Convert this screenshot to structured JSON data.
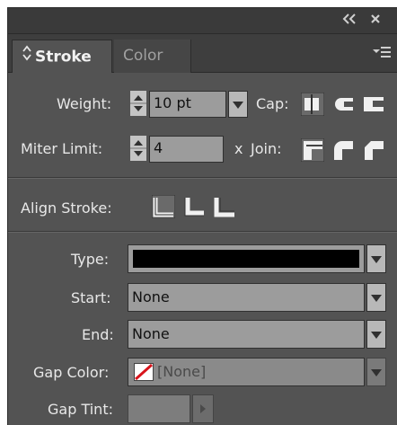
{
  "titlebar": {
    "collapse_icon": "double-chevron-left-icon",
    "close_icon": "close-icon"
  },
  "tabs": [
    {
      "label": "Stroke",
      "active": true,
      "icon": "updown-arrows-icon"
    },
    {
      "label": "Color",
      "active": false
    }
  ],
  "panel_menu_icon": "panel-menu-icon",
  "weight": {
    "label": "Weight:",
    "value": "10 pt"
  },
  "cap": {
    "label": "Cap:",
    "options": [
      "butt-cap-icon",
      "round-cap-icon",
      "projecting-cap-icon"
    ]
  },
  "miter": {
    "label": "Miter Limit:",
    "value": "4",
    "suffix": "x"
  },
  "join": {
    "label": "Join:",
    "options": [
      "miter-join-icon",
      "round-join-icon",
      "bevel-join-icon"
    ]
  },
  "align_stroke": {
    "label": "Align Stroke:",
    "options": [
      "align-center-icon",
      "align-inside-icon",
      "align-outside-icon"
    ]
  },
  "type": {
    "label": "Type:",
    "swatch_color": "#000000"
  },
  "start": {
    "label": "Start:",
    "value": "None"
  },
  "end": {
    "label": "End:",
    "value": "None"
  },
  "gap_color": {
    "label": "Gap Color:",
    "value": "[None]",
    "icon": "none-swatch-icon"
  },
  "gap_tint": {
    "label": "Gap Tint:"
  },
  "colors": {
    "panel_bg": "#535353",
    "field_bg": "#9c9c9c",
    "none_slash": "#d8141c"
  }
}
